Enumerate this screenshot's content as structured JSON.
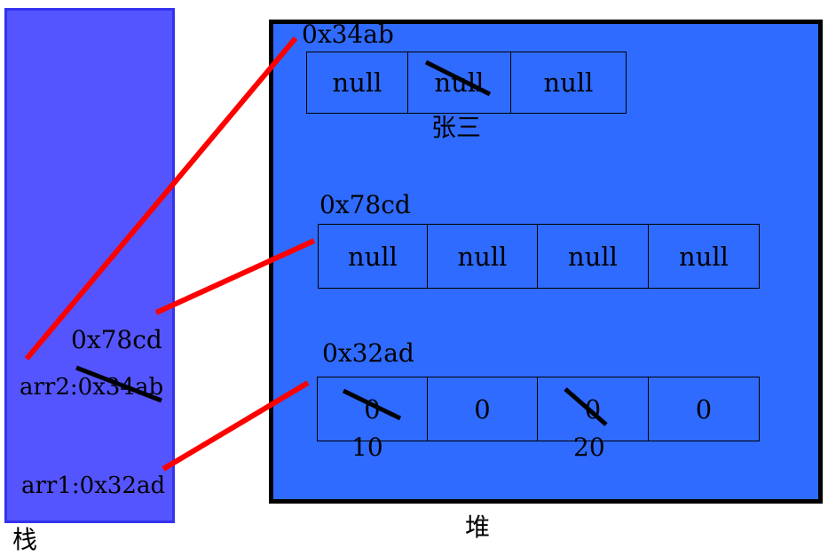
{
  "stack": {
    "title": "栈",
    "arr2_label": "arr2:0x34ab",
    "arr2_new_value": "0x78cd",
    "arr1_label": "arr1:0x32ad"
  },
  "heap": {
    "title": "堆",
    "array_a": {
      "address": "0x34ab",
      "cells": [
        "null",
        "null",
        "null"
      ],
      "new_value": "张三"
    },
    "array_b": {
      "address": "0x78cd",
      "cells": [
        "null",
        "null",
        "null",
        "null"
      ]
    },
    "array_c": {
      "address": "0x32ad",
      "cells": [
        "0",
        "0",
        "0",
        "0"
      ],
      "new_values": [
        "10",
        "20"
      ]
    }
  },
  "colors": {
    "stack_fill": "#5555ff",
    "heap_fill": "#2f6bff",
    "pointer_line": "#ff0000",
    "strike_line": "#000000"
  }
}
